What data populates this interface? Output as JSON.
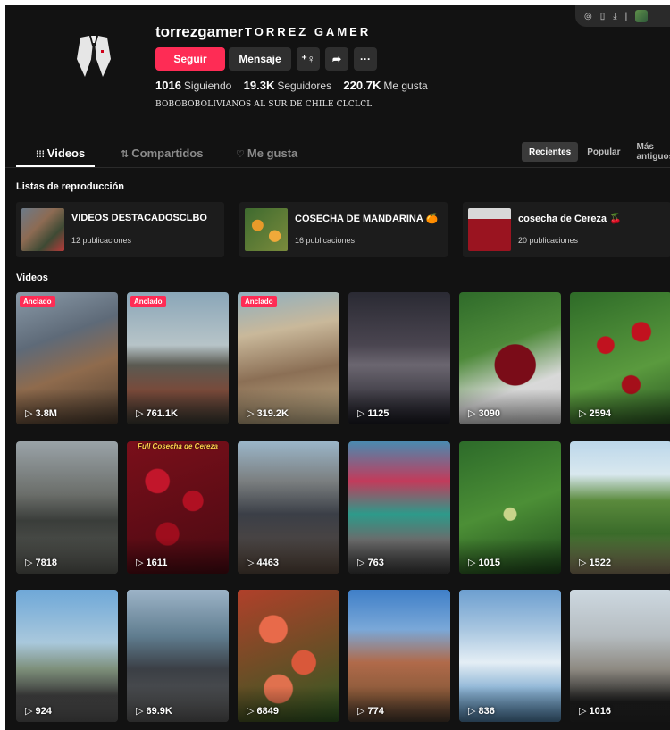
{
  "profile": {
    "username": "torrezgamer",
    "display_name": "TORREZ GAMER",
    "follow_label": "Seguir",
    "message_label": "Mensaje",
    "following_count": "1016",
    "following_label": "Siguiendo",
    "followers_count": "19.3K",
    "followers_label": "Seguidores",
    "likes_count": "220.7K",
    "likes_label": "Me gusta",
    "bio": "BOBOBOBOLIVIANOS AL SUR DE CHILE CLCLCL"
  },
  "tabs": [
    {
      "label": "Videos",
      "icon": "grid-icon"
    },
    {
      "label": "Compartidos",
      "icon": "repost-icon"
    },
    {
      "label": "Me gusta",
      "icon": "heart-outline-icon"
    }
  ],
  "sort_options": [
    "Recientes",
    "Popular",
    "Más antiguos"
  ],
  "playlists_title": "Listas de reproducción",
  "playlists": [
    {
      "name": "VIDEOS DESTACADOSCLBO",
      "count": "12 publicaciones"
    },
    {
      "name": "COSECHA DE MANDARINA 🍊",
      "count": "16 publicaciones"
    },
    {
      "name": "cosecha de Cereza 🍒",
      "count": "20 publicaciones"
    }
  ],
  "videos_title": "Videos",
  "pinned_label": "Anclado",
  "videos": [
    {
      "views": "▷ 3.8M",
      "pinned": true,
      "overlay": ""
    },
    {
      "views": "▷ 761.1K",
      "pinned": true,
      "overlay": ""
    },
    {
      "views": "▷ 319.2K",
      "pinned": true,
      "overlay": ""
    },
    {
      "views": "▷ 1125",
      "pinned": false,
      "overlay": ""
    },
    {
      "views": "▷ 3090",
      "pinned": false,
      "overlay": ""
    },
    {
      "views": "▷ 2594",
      "pinned": false,
      "overlay": ""
    },
    {
      "views": "▷ 7818",
      "pinned": false,
      "overlay": ""
    },
    {
      "views": "▷ 1611",
      "pinned": false,
      "overlay": "Full Cosecha de Cereza"
    },
    {
      "views": "▷ 4463",
      "pinned": false,
      "overlay": ""
    },
    {
      "views": "▷ 763",
      "pinned": false,
      "overlay": ""
    },
    {
      "views": "▷ 1015",
      "pinned": false,
      "overlay": ""
    },
    {
      "views": "▷ 1522",
      "pinned": false,
      "overlay": ""
    },
    {
      "views": "▷ 924",
      "pinned": false,
      "overlay": ""
    },
    {
      "views": "▷ 69.9K",
      "pinned": false,
      "overlay": ""
    },
    {
      "views": "▷ 6849",
      "pinned": false,
      "overlay": ""
    },
    {
      "views": "▷ 774",
      "pinned": false,
      "overlay": ""
    },
    {
      "views": "▷ 836",
      "pinned": false,
      "overlay": ""
    },
    {
      "views": "▷ 1016",
      "pinned": false,
      "overlay": ""
    }
  ],
  "colors": {
    "accent": "#fe2c55",
    "background": "#121212",
    "button_secondary": "#2f2f2f"
  }
}
